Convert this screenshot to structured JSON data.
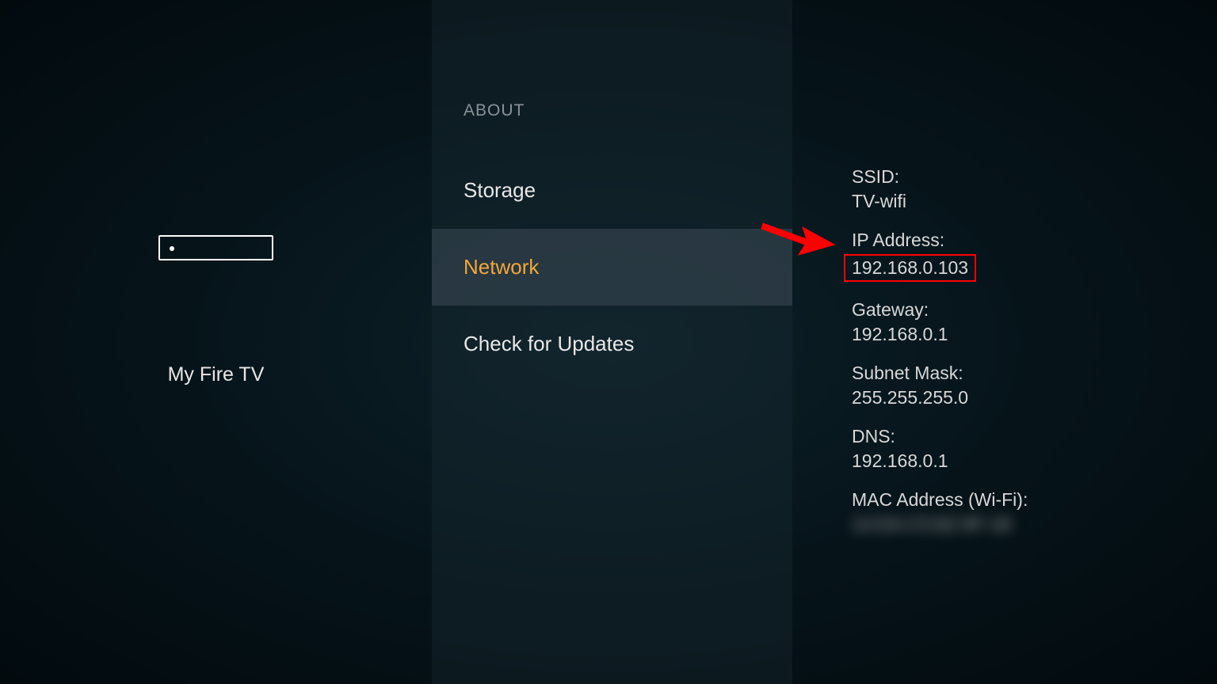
{
  "leftPanel": {
    "deviceLabel": "My Fire TV"
  },
  "middlePanel": {
    "sectionHeader": "ABOUT",
    "items": [
      {
        "label": "Storage",
        "selected": false
      },
      {
        "label": "Network",
        "selected": true
      },
      {
        "label": "Check for Updates",
        "selected": false
      }
    ]
  },
  "rightPanel": {
    "details": [
      {
        "label": "SSID:",
        "value": "TV-wifi",
        "highlight": false
      },
      {
        "label": "IP Address:",
        "value": "192.168.0.103",
        "highlight": true
      },
      {
        "label": "Gateway:",
        "value": "192.168.0.1",
        "highlight": false
      },
      {
        "label": "Subnet Mask:",
        "value": "255.255.255.0",
        "highlight": false
      },
      {
        "label": "DNS:",
        "value": "192.168.0.1",
        "highlight": false
      },
      {
        "label": "MAC Address (Wi-Fi):",
        "value": "14:DA:C5:B2:9F:1B",
        "highlight": false,
        "blurred": true
      }
    ]
  }
}
